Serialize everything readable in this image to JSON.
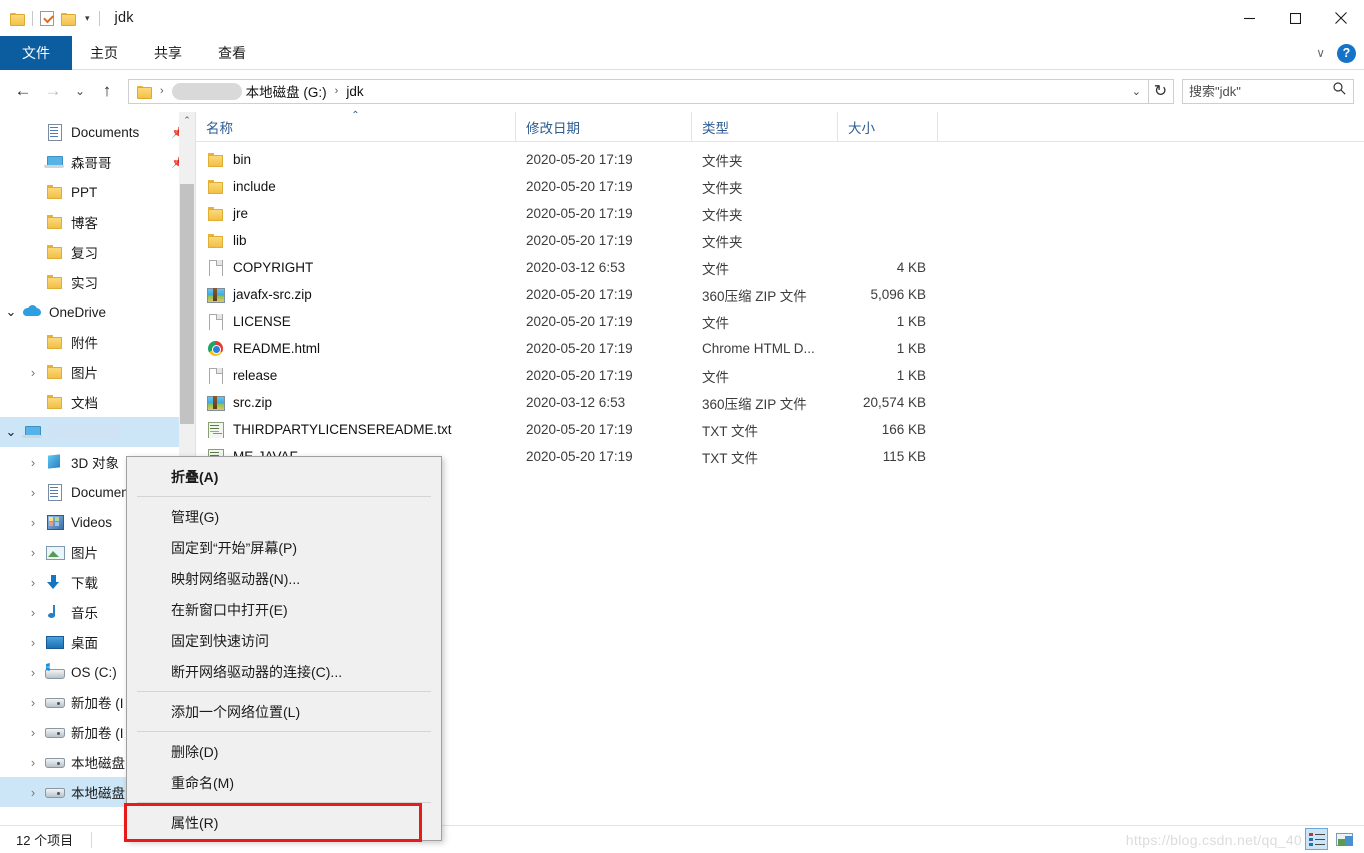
{
  "window": {
    "title": "jdk",
    "quick_access": [
      "folder-icon",
      "properties-checkbox-icon",
      "new-folder-icon",
      "customize-caret-icon"
    ],
    "controls": {
      "minimize": "—",
      "maximize": "☐",
      "close": "✕"
    }
  },
  "ribbon": {
    "tabs": [
      {
        "label": "文件",
        "active": true
      },
      {
        "label": "主页",
        "active": false
      },
      {
        "label": "共享",
        "active": false
      },
      {
        "label": "查看",
        "active": false
      }
    ],
    "collapse_caret": "∨",
    "help_label": "?"
  },
  "addressbar": {
    "back": "←",
    "forward": "→",
    "recent_caret": "⌄",
    "up": "↑",
    "breadcrumb": [
      {
        "type": "icon",
        "label": "folder-icon"
      },
      {
        "type": "redacted",
        "label": ""
      },
      {
        "type": "text",
        "label": "本地磁盘 (G:)"
      },
      {
        "type": "text",
        "label": "jdk"
      }
    ],
    "separator": "›",
    "dropdown_caret": "⌄",
    "refresh": "↻",
    "search_placeholder": "搜索\"jdk\"",
    "search_value": "",
    "search_icon": "⌕"
  },
  "sidebar": {
    "items": [
      {
        "label": "Documents",
        "icon": "documents-icon",
        "indent": 1,
        "twisty": "",
        "pinned": true,
        "selected": false
      },
      {
        "label": "森哥哥",
        "icon": "laptop-icon",
        "indent": 1,
        "twisty": "",
        "pinned": true,
        "selected": false
      },
      {
        "label": "PPT",
        "icon": "folder-icon",
        "indent": 1,
        "twisty": "",
        "pinned": false,
        "selected": false
      },
      {
        "label": "博客",
        "icon": "folder-icon",
        "indent": 1,
        "twisty": "",
        "pinned": false,
        "selected": false
      },
      {
        "label": "复习",
        "icon": "folder-icon",
        "indent": 1,
        "twisty": "",
        "pinned": false,
        "selected": false
      },
      {
        "label": "实习",
        "icon": "folder-icon",
        "indent": 1,
        "twisty": "",
        "pinned": false,
        "selected": false
      },
      {
        "label": "OneDrive",
        "icon": "onedrive-cloud-icon",
        "indent": 0,
        "twisty": "open",
        "pinned": false,
        "selected": false
      },
      {
        "label": "附件",
        "icon": "folder-icon",
        "indent": 1,
        "twisty": "",
        "pinned": false,
        "selected": false
      },
      {
        "label": "图片",
        "icon": "folder-icon",
        "indent": 1,
        "twisty": "closed",
        "pinned": false,
        "selected": false
      },
      {
        "label": "文档",
        "icon": "folder-icon",
        "indent": 1,
        "twisty": "",
        "pinned": false,
        "selected": false
      },
      {
        "label": "",
        "icon": "this-pc-icon",
        "indent": 0,
        "twisty": "open",
        "pinned": false,
        "selected": true,
        "redacted": true
      },
      {
        "label": "3D 对象",
        "icon": "3d-objects-icon",
        "indent": 1,
        "twisty": "closed",
        "pinned": false,
        "selected": false
      },
      {
        "label": "Documents",
        "icon": "documents-icon",
        "indent": 1,
        "twisty": "closed",
        "pinned": false,
        "selected": false
      },
      {
        "label": "Videos",
        "icon": "videos-icon",
        "indent": 1,
        "twisty": "closed",
        "pinned": false,
        "selected": false
      },
      {
        "label": "图片",
        "icon": "pictures-icon",
        "indent": 1,
        "twisty": "closed",
        "pinned": false,
        "selected": false
      },
      {
        "label": "下载",
        "icon": "downloads-icon",
        "indent": 1,
        "twisty": "closed",
        "pinned": false,
        "selected": false
      },
      {
        "label": "音乐",
        "icon": "music-icon",
        "indent": 1,
        "twisty": "closed",
        "pinned": false,
        "selected": false
      },
      {
        "label": "桌面",
        "icon": "desktop-icon",
        "indent": 1,
        "twisty": "closed",
        "pinned": false,
        "selected": false
      },
      {
        "label": "OS (C:)",
        "icon": "os-drive-icon",
        "indent": 1,
        "twisty": "closed",
        "pinned": false,
        "selected": false
      },
      {
        "label": "新加卷 (I",
        "icon": "drive-icon",
        "indent": 1,
        "twisty": "closed",
        "pinned": false,
        "selected": false
      },
      {
        "label": "新加卷 (I",
        "icon": "drive-icon",
        "indent": 1,
        "twisty": "closed",
        "pinned": false,
        "selected": false
      },
      {
        "label": "本地磁盘",
        "icon": "drive-icon",
        "indent": 1,
        "twisty": "closed",
        "pinned": false,
        "selected": false
      },
      {
        "label": "本地磁盘",
        "icon": "drive-icon",
        "indent": 1,
        "twisty": "closed",
        "pinned": false,
        "selected": true
      }
    ],
    "scroll_up_arrow": "⌃"
  },
  "filelist": {
    "columns": [
      {
        "key": "name",
        "label": "名称",
        "sorted": true,
        "sort_caret": "⌃"
      },
      {
        "key": "date",
        "label": "修改日期",
        "sorted": false
      },
      {
        "key": "type",
        "label": "类型",
        "sorted": false
      },
      {
        "key": "size",
        "label": "大小",
        "sorted": false
      }
    ],
    "rows": [
      {
        "name": "bin",
        "icon": "folder-icon",
        "date": "2020-05-20 17:19",
        "type": "文件夹",
        "size": ""
      },
      {
        "name": "include",
        "icon": "folder-icon",
        "date": "2020-05-20 17:19",
        "type": "文件夹",
        "size": ""
      },
      {
        "name": "jre",
        "icon": "folder-icon",
        "date": "2020-05-20 17:19",
        "type": "文件夹",
        "size": ""
      },
      {
        "name": "lib",
        "icon": "folder-icon",
        "date": "2020-05-20 17:19",
        "type": "文件夹",
        "size": ""
      },
      {
        "name": "COPYRIGHT",
        "icon": "file-icon",
        "date": "2020-03-12 6:53",
        "type": "文件",
        "size": "4 KB"
      },
      {
        "name": "javafx-src.zip",
        "icon": "zip-icon",
        "date": "2020-05-20 17:19",
        "type": "360压缩 ZIP 文件",
        "size": "5,096 KB"
      },
      {
        "name": "LICENSE",
        "icon": "file-icon",
        "date": "2020-05-20 17:19",
        "type": "文件",
        "size": "1 KB"
      },
      {
        "name": "README.html",
        "icon": "chrome-icon",
        "date": "2020-05-20 17:19",
        "type": "Chrome HTML D...",
        "size": "1 KB"
      },
      {
        "name": "release",
        "icon": "file-icon",
        "date": "2020-05-20 17:19",
        "type": "文件",
        "size": "1 KB"
      },
      {
        "name": "src.zip",
        "icon": "zip-icon",
        "date": "2020-03-12 6:53",
        "type": "360压缩 ZIP 文件",
        "size": "20,574 KB"
      },
      {
        "name": "THIRDPARTYLICENSEREADME.txt",
        "icon": "txt-icon",
        "date": "2020-05-20 17:19",
        "type": "TXT 文件",
        "size": "166 KB"
      },
      {
        "name": "ME-JAVAF...",
        "icon": "txt-icon",
        "date": "2020-05-20 17:19",
        "type": "TXT 文件",
        "size": "115 KB"
      }
    ]
  },
  "context_menu": {
    "items": [
      {
        "label": "折叠(A)",
        "bold": true,
        "separator_after": true,
        "highlighted": false
      },
      {
        "label": "管理(G)",
        "bold": false,
        "separator_after": false,
        "highlighted": false
      },
      {
        "label": "固定到“开始”屏幕(P)",
        "bold": false,
        "separator_after": false,
        "highlighted": false
      },
      {
        "label": "映射网络驱动器(N)...",
        "bold": false,
        "separator_after": false,
        "highlighted": false
      },
      {
        "label": "在新窗口中打开(E)",
        "bold": false,
        "separator_after": false,
        "highlighted": false
      },
      {
        "label": "固定到快速访问",
        "bold": false,
        "separator_after": false,
        "highlighted": false
      },
      {
        "label": "断开网络驱动器的连接(C)...",
        "bold": false,
        "separator_after": true,
        "highlighted": false
      },
      {
        "label": "添加一个网络位置(L)",
        "bold": false,
        "separator_after": true,
        "highlighted": false
      },
      {
        "label": "删除(D)",
        "bold": false,
        "separator_after": false,
        "highlighted": false
      },
      {
        "label": "重命名(M)",
        "bold": false,
        "separator_after": true,
        "highlighted": false
      },
      {
        "label": "属性(R)",
        "bold": false,
        "separator_after": false,
        "highlighted": true
      }
    ],
    "highlight_color": "#e81b1b"
  },
  "statusbar": {
    "item_count": "12 个项目",
    "watermark": "https://blog.csdn.net/qq_40",
    "view_buttons": [
      {
        "name": "details-view-button",
        "active": true
      },
      {
        "name": "large-icons-view-button",
        "active": false
      }
    ]
  }
}
